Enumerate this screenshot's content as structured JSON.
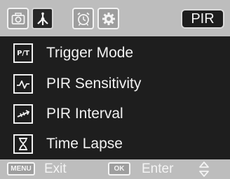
{
  "header": {
    "tabs": [
      {
        "icon": "camera-icon",
        "active": false
      },
      {
        "icon": "network-icon",
        "active": true
      },
      {
        "icon": "alarm-clock-icon",
        "active": false
      },
      {
        "icon": "gear-icon",
        "active": false
      }
    ],
    "mode": "PIR"
  },
  "menu": {
    "items": [
      {
        "icon": "trigger-mode-icon",
        "icon_text": "P/T",
        "label": "Trigger Mode"
      },
      {
        "icon": "sensitivity-wave-icon",
        "label": "PIR Sensitivity"
      },
      {
        "icon": "interval-icon",
        "label": "PIR Interval"
      },
      {
        "icon": "hourglass-icon",
        "label": "Time Lapse"
      }
    ]
  },
  "footer": {
    "menu_key": "MENU",
    "menu_label": "Exit",
    "ok_key": "OK",
    "ok_label": "Enter",
    "updown_icon": "up-down-arrows-icon"
  },
  "colors": {
    "background": "#1e1e1e",
    "bar": "#bdbdbd",
    "tab_inactive": "#9e9e9e",
    "text": "#f2f2f2"
  }
}
